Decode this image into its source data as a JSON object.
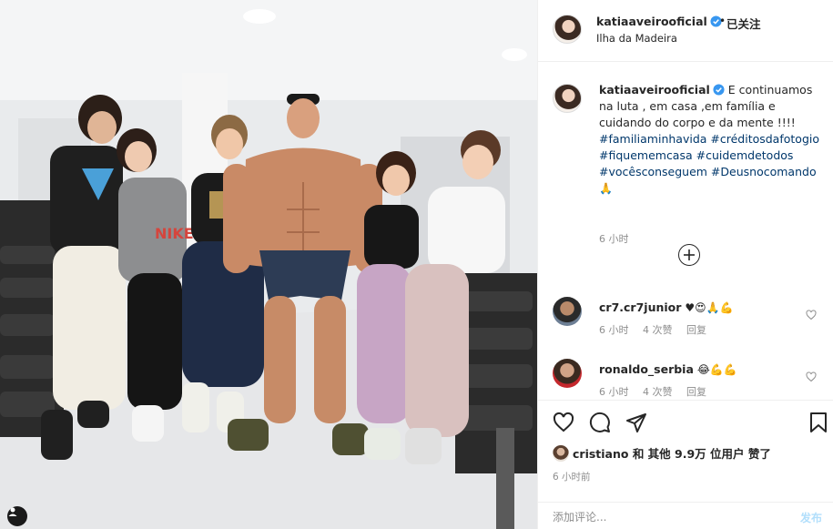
{
  "header": {
    "username": "katiaaveirooficial",
    "dot": "•",
    "follow_label": "已关注",
    "location": "Ilha da Madeira"
  },
  "caption": {
    "username": "katiaaveirooficial",
    "text": "E continuamos na luta , em casa ,em família e cuidando do corpo e da mente !!!!",
    "hashtags": "#familiaminhavida #créditosdafotogio #fiquememcasa #cuidemdetodos #vocêsconseguem #Deusnocomando",
    "emoji": "🙏",
    "time": "6 小时"
  },
  "comments": [
    {
      "username": "cr7.cr7junior",
      "text": "♥😍🙏💪",
      "time": "6 小时",
      "likes": "4 次赞",
      "reply": "回复",
      "avatar": "cr7junior-avatar"
    },
    {
      "username": "ronaldo_serbia",
      "text": "😂💪💪",
      "time": "6 小时",
      "likes": "4 次赞",
      "reply": "回复",
      "avatar": "ronaldo-serbia-avatar"
    }
  ],
  "likes": {
    "text": "cristiano 和 其他 9.9万 位用户 赞了"
  },
  "post_time": "6 小时前",
  "add_comment": {
    "placeholder": "添加评论...",
    "post_label": "发布"
  },
  "colors": {
    "verified": "#3897f0",
    "link": "#00376b",
    "muted": "#8e8e8e",
    "post_disabled": "#b2dffc"
  }
}
